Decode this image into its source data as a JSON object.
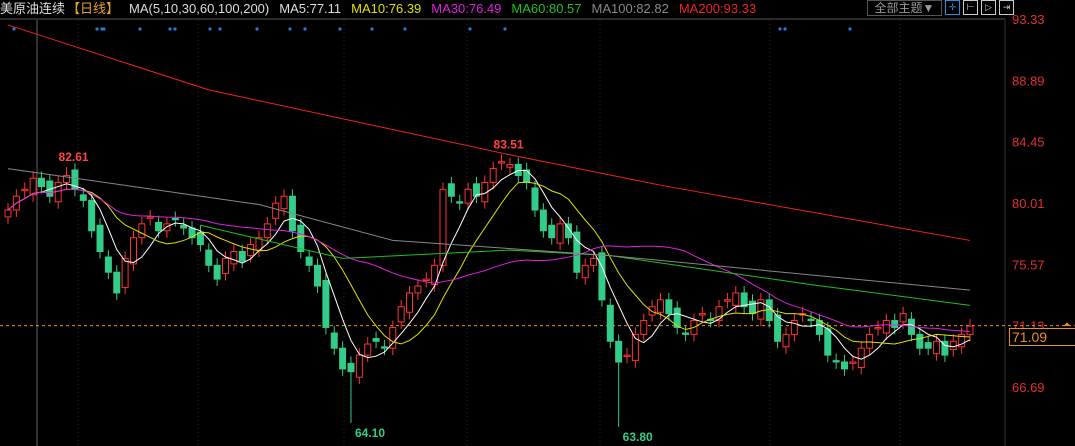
{
  "header": {
    "symbol": "美原油连续",
    "period": "【日线】",
    "ma_label": "MA(5,10,30,60,100,200)",
    "ma5": "MA5:77.11",
    "ma10": "MA10:76.39",
    "ma30": "MA30:76.49",
    "ma60": "MA60:80.57",
    "ma100": "MA100:82.82",
    "ma200": "MA200:93.33",
    "theme": "全部主题▼"
  },
  "colors": {
    "up": "#ff3333",
    "down": "#33cc88",
    "ma5": "#ffffff",
    "ma10": "#e0e000",
    "ma30": "#e020e0",
    "ma60": "#20c020",
    "ma100": "#888888",
    "ma200": "#ee2222"
  },
  "chart_data": {
    "type": "candlestick",
    "ylim": [
      66.69,
      93.33
    ],
    "yticks": [
      "93.33",
      "88.89",
      "84.45",
      "80.01",
      "75.57",
      "71.13",
      "66.69"
    ],
    "last_price": "71.09",
    "ref_line": 71.13,
    "closes": [
      79.5,
      80.5,
      81.0,
      81.8,
      81.2,
      80.5,
      81.5,
      82.0,
      81.0,
      80.2,
      78.0,
      76.5,
      75.0,
      73.5,
      76.0,
      77.5,
      78.5,
      79.0,
      78.0,
      78.5,
      78.8,
      78.2,
      77.5,
      77.0,
      75.5,
      74.5,
      76.0,
      76.5,
      75.8,
      77.0,
      77.5,
      78.5,
      80.0,
      80.5,
      78.0,
      76.5,
      75.5,
      74.0,
      71.0,
      69.5,
      68.0,
      67.8,
      69.0,
      69.8,
      70.0,
      69.5,
      71.0,
      72.5,
      73.5,
      74.0,
      74.5,
      75.5,
      81.0,
      80.5,
      80.0,
      81.0,
      80.5,
      81.5,
      82.5,
      83.0,
      82.8,
      82.0,
      81.5,
      79.5,
      78.0,
      77.5,
      78.5,
      77.5,
      75.0,
      75.5,
      76.0,
      73.0,
      70.0,
      68.5,
      69.0,
      70.5,
      71.5,
      72.5,
      73.0,
      72.0,
      71.0,
      70.5,
      71.5,
      72.0,
      71.5,
      72.5,
      73.0,
      73.5,
      72.5,
      72.0,
      73.0,
      71.5,
      70.0,
      70.5,
      71.5,
      72.0,
      71.5,
      70.5,
      69.0,
      68.5,
      68.0,
      68.5,
      69.5,
      70.5,
      71.0,
      71.5,
      71.0,
      72.0,
      70.5,
      69.5,
      69.5,
      70.0,
      69.0,
      70.0,
      70.5,
      71.09
    ],
    "annotations": [
      {
        "index": 7,
        "label": "82.61",
        "type": "high"
      },
      {
        "index": 41,
        "label": "64.10",
        "type": "low"
      },
      {
        "index": 59,
        "label": "83.51",
        "type": "high"
      },
      {
        "index": 73,
        "label": "63.80",
        "type": "low"
      }
    ],
    "ma60": [
      [
        23,
        78.4
      ],
      [
        40,
        76.0
      ],
      [
        60,
        76.6
      ],
      [
        72,
        76.2
      ],
      [
        96,
        74.1
      ],
      [
        115,
        72.6
      ]
    ],
    "ma100": [
      [
        0,
        82.5
      ],
      [
        30,
        79.9
      ],
      [
        46,
        77.3
      ],
      [
        72,
        76.2
      ],
      [
        115,
        73.7
      ]
    ],
    "ma200": [
      [
        0,
        92.9
      ],
      [
        24,
        88.2
      ],
      [
        60,
        83.5
      ],
      [
        78,
        81.3
      ],
      [
        115,
        77.3
      ]
    ]
  }
}
